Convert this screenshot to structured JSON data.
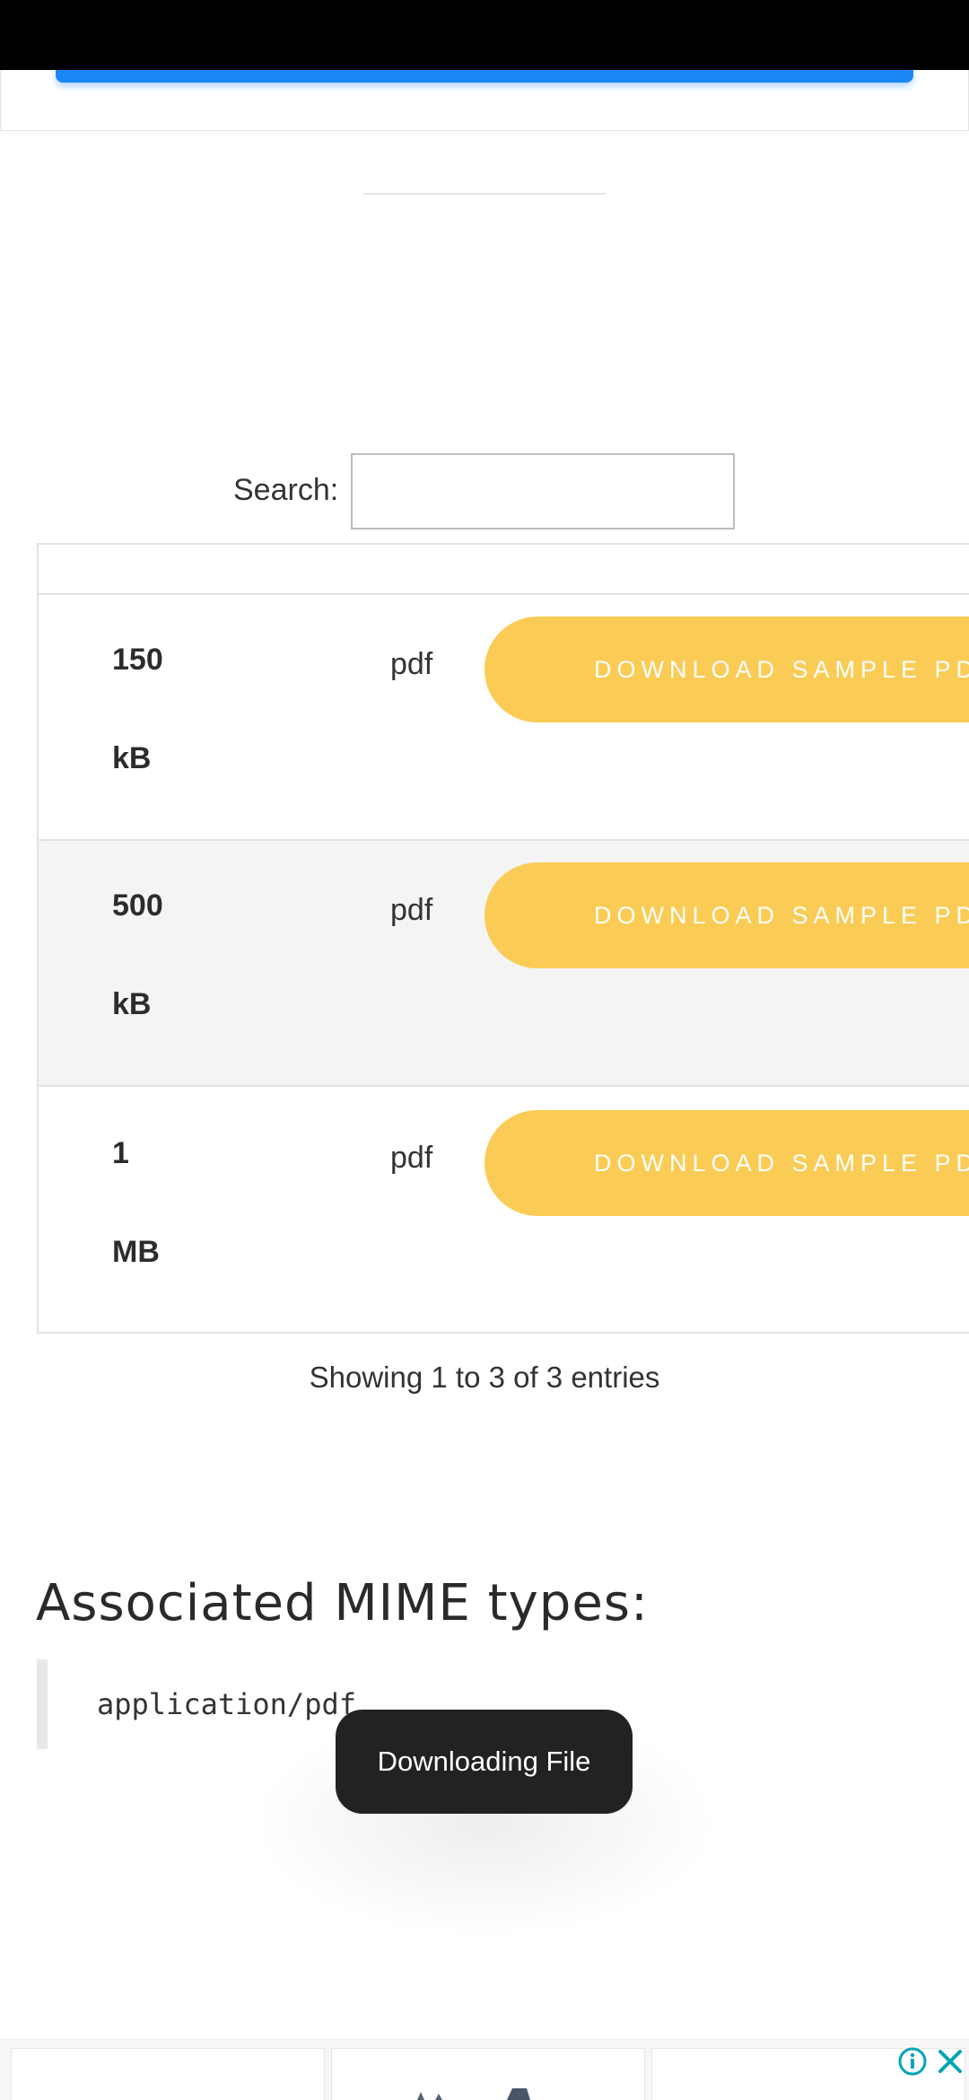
{
  "search": {
    "label": "Search:",
    "value": "",
    "placeholder": ""
  },
  "table": {
    "rows": [
      {
        "size_num": "150",
        "size_unit": "kB",
        "type": "pdf",
        "button": "DOWNLOAD SAMPLE PDF"
      },
      {
        "size_num": "500",
        "size_unit": "kB",
        "type": "pdf",
        "button": "DOWNLOAD SAMPLE PDF"
      },
      {
        "size_num": "1",
        "size_unit": "MB",
        "type": "pdf",
        "button": "DOWNLOAD SAMPLE PDF"
      }
    ]
  },
  "entries_info": "Showing 1 to 3 of 3 entries",
  "mime": {
    "heading": "Associated MIME types:",
    "types": [
      "application/pdf"
    ]
  },
  "toast": {
    "text": "Downloading File"
  },
  "ad": {
    "info_icon": "info-circle-icon",
    "close_icon": "close-x-icon"
  },
  "colors": {
    "accent_blue": "#1a86f7",
    "button_yellow": "#fbcc55",
    "toast_bg": "#222222",
    "ad_icon": "#00a5b5"
  }
}
